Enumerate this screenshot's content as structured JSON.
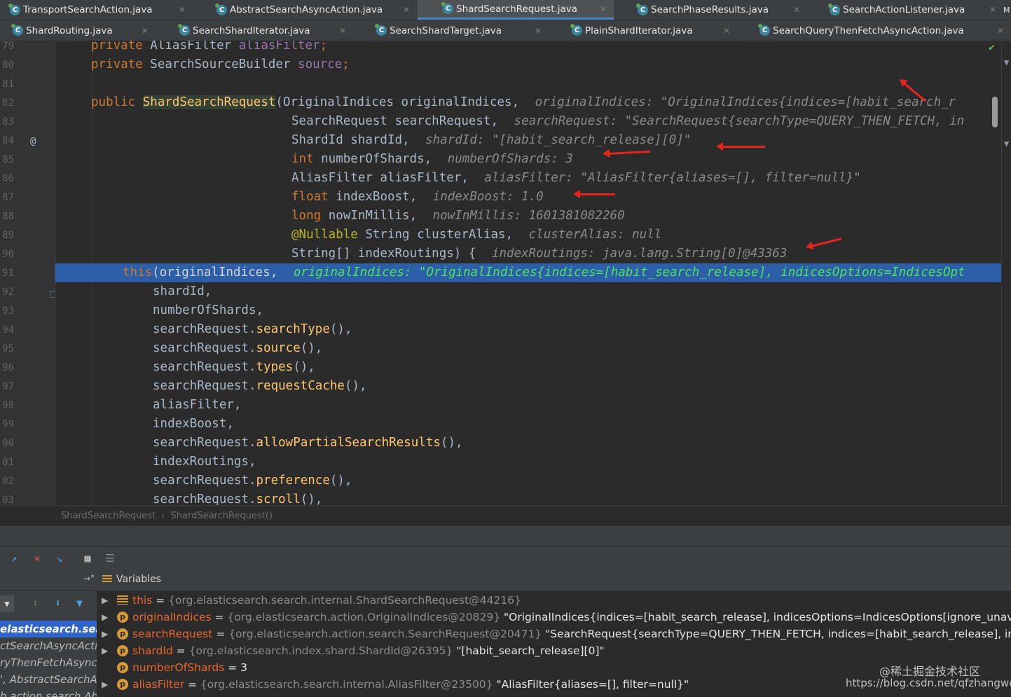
{
  "tabs_row1": [
    {
      "label": "TransportSearchAction.java",
      "active": false
    },
    {
      "label": "AbstractSearchAsyncAction.java",
      "active": false
    },
    {
      "label": "ShardSearchRequest.java",
      "active": true
    },
    {
      "label": "SearchPhaseResults.java",
      "active": false
    },
    {
      "label": "SearchActionListener.java",
      "active": false
    }
  ],
  "tabs_row2": [
    {
      "label": "ShardRouting.java"
    },
    {
      "label": "SearchShardIterator.java"
    },
    {
      "label": "SearchShardTarget.java"
    },
    {
      "label": "PlainShardIterator.java"
    },
    {
      "label": "SearchQueryThenFetchAsyncAction.java"
    }
  ],
  "tab_overflow": "M",
  "line_numbers": [
    "79",
    "80",
    "81",
    "82",
    "83",
    "84",
    "85",
    "86",
    "87",
    "88",
    "89",
    "90",
    "91",
    "92",
    "93",
    "94",
    "95",
    "96",
    "97",
    "98",
    "99",
    "00",
    "01",
    "02",
    "03"
  ],
  "gutter_annotation": "@",
  "code": {
    "l79": {
      "kw": "private",
      "type": " AliasFilter ",
      "field": "aliasFilter",
      "end": ";"
    },
    "l80": {
      "kw": "private",
      "type": " SearchSourceBuilder ",
      "field": "source",
      "end": ";"
    },
    "l82": {
      "kw": "public",
      "name": "ShardSearchRequest",
      "params": "(OriginalIndices originalIndices, ",
      "hint": "originalIndices: \"OriginalIndices{indices=[habit_search_r"
    },
    "l83": {
      "code": "SearchRequest searchRequest, ",
      "hint": "searchRequest: \"SearchRequest{searchType=QUERY_THEN_FETCH, in"
    },
    "l84": {
      "code": "ShardId shardId, ",
      "hint": "shardId: \"[habit_search_release][0]\""
    },
    "l85": {
      "kw": "int",
      "code": " numberOfShards, ",
      "hint": "numberOfShards: 3"
    },
    "l86": {
      "code": "AliasFilter aliasFilter, ",
      "hint": "aliasFilter: \"AliasFilter{aliases=[], filter=null}\""
    },
    "l87": {
      "kw": "float",
      "code": " indexBoost, ",
      "hint": "indexBoost: 1.0"
    },
    "l88": {
      "kw": "long",
      "code": " nowInMillis, ",
      "hint": "nowInMillis: 1601381082260"
    },
    "l89": {
      "ann": "@Nullable",
      "code": " String clusterAlias, ",
      "hint": "clusterAlias: null"
    },
    "l90": {
      "code": "String[] indexRoutings) { ",
      "hint": "indexRoutings: java.lang.String[0]@43363"
    },
    "l91": {
      "kw": "this",
      "code": "(originalIndices, ",
      "hint": "originalIndices: \"OriginalIndices{indices=[habit_search_release], indicesOptions=IndicesOpt"
    },
    "l92": "shardId,",
    "l93": "numberOfShards,",
    "l94": {
      "obj": "searchRequest.",
      "m": "searchType",
      "end": "(),"
    },
    "l95": {
      "obj": "searchRequest.",
      "m": "source",
      "end": "(),"
    },
    "l96": {
      "obj": "searchRequest.",
      "m": "types",
      "end": "(),"
    },
    "l97": {
      "obj": "searchRequest.",
      "m": "requestCache",
      "end": "(),"
    },
    "l98": "aliasFilter,",
    "l99": "indexBoost,",
    "l100": {
      "obj": "searchRequest.",
      "m": "allowPartialSearchResults",
      "end": "(),"
    },
    "l101": "indexRoutings,",
    "l102": {
      "obj": "searchRequest.",
      "m": "preference",
      "end": "(),"
    },
    "l103": {
      "obj": "searchRequest.",
      "m": "scroll",
      "end": "(),"
    }
  },
  "breadcrumb": [
    "ShardSearchRequest",
    "ShardSearchRequest()"
  ],
  "breadcrumb_separator": "›",
  "variables_title": "Variables",
  "frames": [
    {
      "label": "elasticsearch.searc",
      "selected": true
    },
    {
      "label": "ctSearchAsyncActi",
      "selected": false
    },
    {
      "label": "ryThenFetchAsync",
      "selected": false
    },
    {
      "label": "', AbstractSearchA",
      "selected": false
    },
    {
      "label": "h.action.search.Ab",
      "selected": false
    }
  ],
  "variables": [
    {
      "icon": "lines",
      "name": "this",
      "ref": "{org.elasticsearch.search.internal.ShardSearchRequest@44216}",
      "value": ""
    },
    {
      "icon": "p",
      "name": "originalIndices",
      "ref": "{org.elasticsearch.action.OriginalIndices@20829}",
      "value": "\"OriginalIndices{indices=[habit_search_release], indicesOptions=IndicesOptions[ignore_unav"
    },
    {
      "icon": "p",
      "name": "searchRequest",
      "ref": "{org.elasticsearch.action.search.SearchRequest@20471}",
      "value": "\"SearchRequest{searchType=QUERY_THEN_FETCH, indices=[habit_search_release], indi"
    },
    {
      "icon": "p",
      "name": "shardId",
      "ref": "{org.elasticsearch.index.shard.ShardId@26395}",
      "value": "\"[habit_search_release][0]\""
    },
    {
      "icon": "p",
      "name": "numberOfShards",
      "ref": "",
      "value": "3"
    },
    {
      "icon": "p",
      "name": "aliasFilter",
      "ref": "{org.elasticsearch.search.internal.AliasFilter@23500}",
      "value": "\"AliasFilter{aliases=[], filter=null}\""
    }
  ],
  "watermark": {
    "line1": "@稀土掘金技术社区",
    "line2": "https://blog.csdn.net/qfzhangwei"
  },
  "colors": {
    "keyword": "#cc7832",
    "field": "#9876aa",
    "method": "#ffc66d",
    "selection": "#2d5fa8",
    "arrow": "#e5261f"
  }
}
